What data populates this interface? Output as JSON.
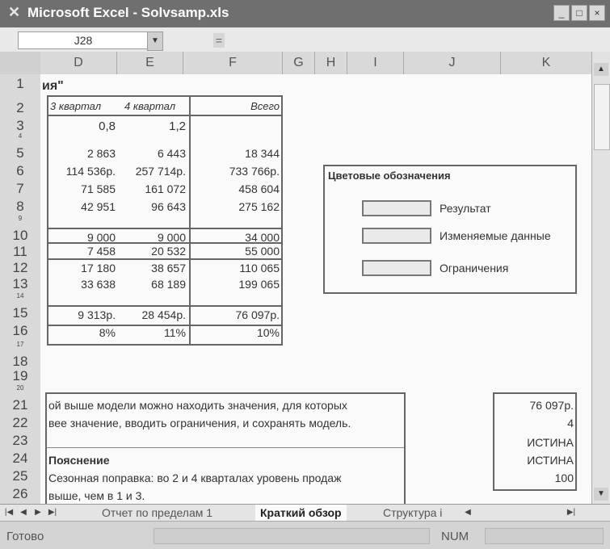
{
  "window": {
    "title": "Microsoft Excel - Solvsamp.xls"
  },
  "formula_bar": {
    "name_box": "J28",
    "equals": "="
  },
  "columns": [
    "D",
    "E",
    "F",
    "G",
    "H",
    "I",
    "J",
    "K"
  ],
  "rows": [
    "1",
    "2",
    "3",
    "4",
    "5",
    "6",
    "7",
    "8",
    "9",
    "10",
    "11",
    "12",
    "13",
    "14",
    "15",
    "16",
    "17",
    "18",
    "19",
    "20",
    "21",
    "22",
    "23",
    "24",
    "25",
    "26"
  ],
  "cells": {
    "title_fragment": "ия\"",
    "hdr_q3": "3 квартал",
    "hdr_q4": "4 квартал",
    "hdr_total": "Всего",
    "r3": [
      "0,8",
      "1,2"
    ],
    "r5": [
      "2 863",
      "6 443",
      "18 344"
    ],
    "r6": [
      "114 536р.",
      "257 714р.",
      "733 766р."
    ],
    "r7": [
      "71 585",
      "161 072",
      "458 604"
    ],
    "r8": [
      "42 951",
      "96 643",
      "275 162"
    ],
    "r10": [
      "9 000",
      "9 000",
      "34 000"
    ],
    "r11": [
      "7 458",
      "20 532",
      "55 000"
    ],
    "r12": [
      "17 180",
      "38 657",
      "110 065"
    ],
    "r13": [
      "33 638",
      "68 189",
      "199 065"
    ],
    "r15": [
      "9 313р.",
      "28 454р.",
      "76 097р."
    ],
    "r16": [
      "8%",
      "11%",
      "10%"
    ]
  },
  "legend": {
    "title": "Цветовые обозначения",
    "items": [
      "Результат",
      "Изменяемые данные",
      "Ограничения"
    ]
  },
  "notes": {
    "line21": "ой выше модели можно находить значения, для которых",
    "line22": "вее значение, вводить ограничения, и сохранять модель.",
    "line24": "Пояснение",
    "line25": "Сезонная поправка:  во 2 и 4 кварталах уровень продаж",
    "line26": "выше, чем в 1 и 3."
  },
  "side_values": [
    "76 097р.",
    "4",
    "ИСТИНА",
    "ИСТИНА",
    "100"
  ],
  "sheet_tabs": [
    "Отчет по пределам 1",
    "Краткий обзор",
    "Структура i"
  ],
  "active_tab": "Краткий обзор",
  "status": {
    "ready": "Готово",
    "num": "NUM"
  }
}
